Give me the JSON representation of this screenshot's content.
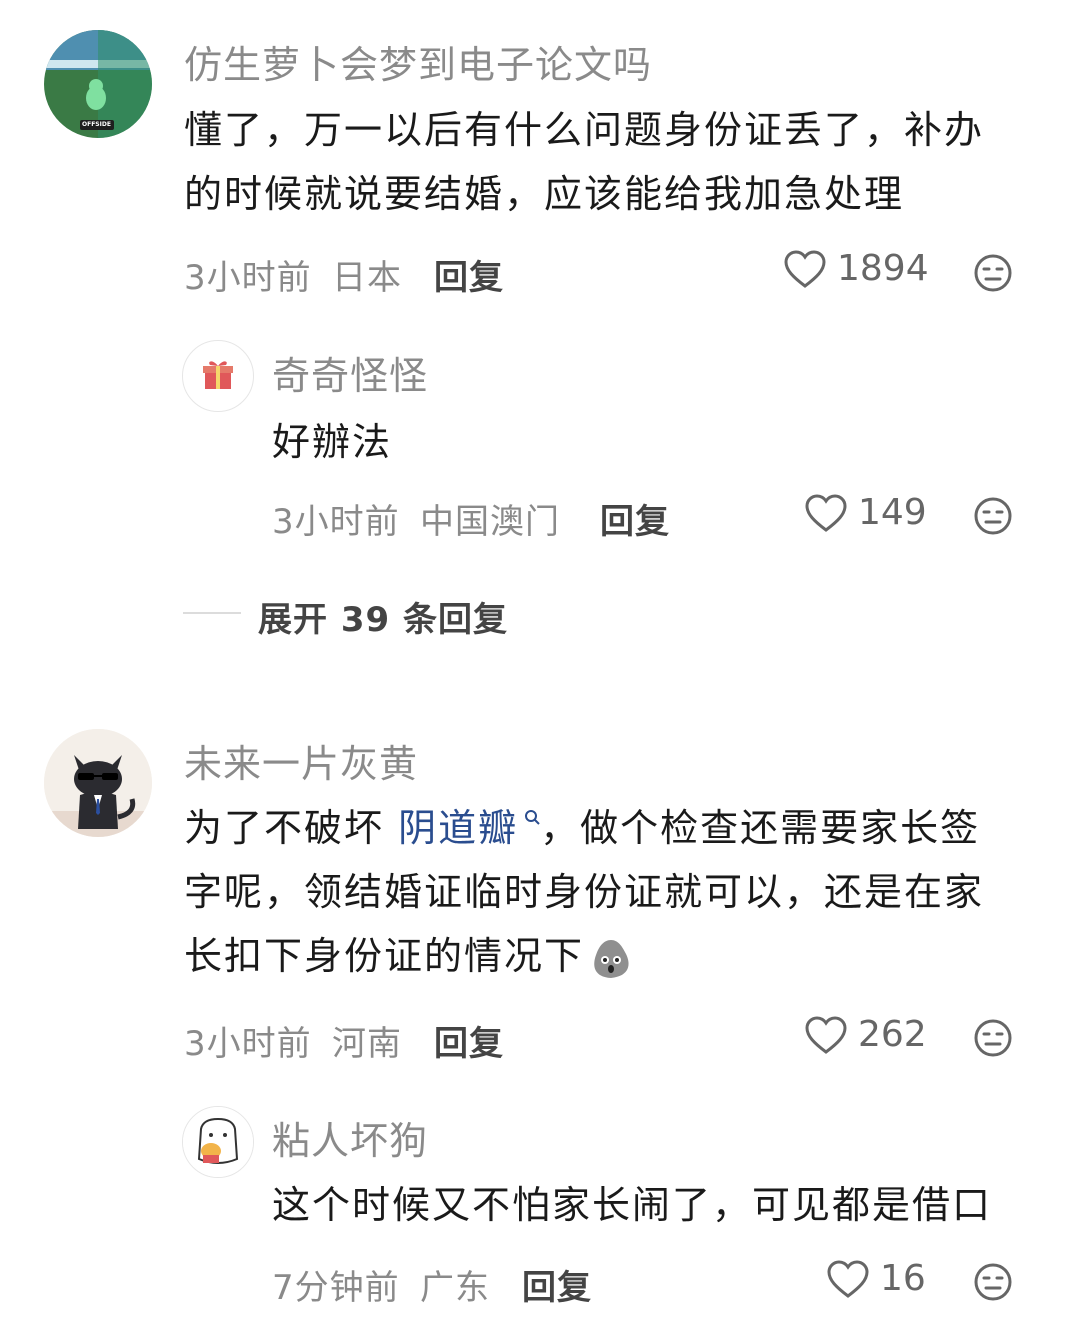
{
  "comments": [
    {
      "user": "仿生萝卜会梦到电子论文吗",
      "text_line1": "懂了，万一以后有什么问题身份证丢了，补办",
      "text_line2": "的时候就说要结婚，应该能给我加急处理",
      "time": "3小时前",
      "location": "日本",
      "reply_label": "回复",
      "likes": "1894",
      "avatar_badge": "OFFSIDE",
      "replies": [
        {
          "user": "奇奇怪怪",
          "text": "好辦法",
          "time": "3小时前",
          "location": "中国澳门",
          "reply_label": "回复",
          "likes": "149",
          "avatar_icon": "gift-icon"
        }
      ],
      "expand_label": "展开 39 条回复"
    },
    {
      "user": "未来一片灰黄",
      "text_line1_prefix": "为了不破坏 ",
      "mention": "阴道瓣",
      "text_line1_suffix": "，做个检查还需要家长签",
      "text_line2": "字呢，领结婚证临时身份证就可以，还是在家",
      "text_line3": "长扣下身份证的情况下",
      "inline_emoji": "shocked-blob-emoji",
      "time": "3小时前",
      "location": "河南",
      "reply_label": "回复",
      "likes": "262",
      "replies": [
        {
          "user": "粘人坏狗",
          "text": "这个时候又不怕家长闹了，可见都是借口",
          "time": "7分钟前",
          "location": "广东",
          "reply_label": "回复",
          "likes": "16"
        }
      ]
    }
  ],
  "colors": {
    "username": "#8a8a8a",
    "meta": "#8a8a8a",
    "mention": "#2a4d8f",
    "text": "#1a1a1a"
  }
}
